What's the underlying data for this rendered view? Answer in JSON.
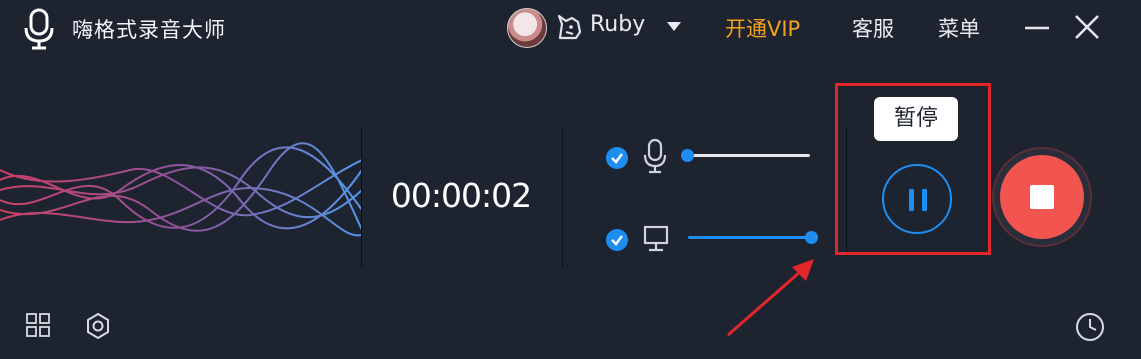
{
  "app": {
    "title": "嗨格式录音大师",
    "icon": "microphone-icon"
  },
  "header": {
    "username": "Ruby",
    "vip_badge_icon": "unicorn-vip-icon",
    "open_vip_label": "开通VIP",
    "support_label": "客服",
    "menu_label": "菜单"
  },
  "recorder": {
    "elapsed": "00:00:02",
    "sources": [
      {
        "name": "microphone",
        "icon": "microphone-icon",
        "checked": true,
        "volume": 0.0
      },
      {
        "name": "system-audio",
        "icon": "monitor-icon",
        "checked": true,
        "volume": 1.0
      }
    ],
    "pause_tooltip": "暂停"
  },
  "colors": {
    "background": "#1e2330",
    "accent": "#1d8ef0",
    "vip": "#f3a21b",
    "stop": "#f2554f",
    "annotation": "#e2262a"
  },
  "footer": {
    "icons": [
      "grid-icon",
      "gear-icon",
      "clock-icon"
    ]
  }
}
